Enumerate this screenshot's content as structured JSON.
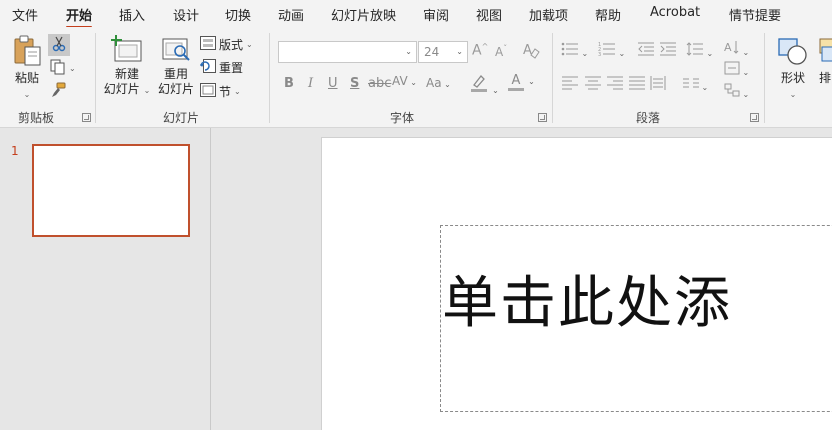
{
  "menu": {
    "tabs": [
      {
        "label": "文件",
        "active": false
      },
      {
        "label": "开始",
        "active": true
      },
      {
        "label": "插入",
        "active": false
      },
      {
        "label": "设计",
        "active": false
      },
      {
        "label": "切换",
        "active": false
      },
      {
        "label": "动画",
        "active": false
      },
      {
        "label": "幻灯片放映",
        "active": false
      },
      {
        "label": "审阅",
        "active": false
      },
      {
        "label": "视图",
        "active": false
      },
      {
        "label": "加载项",
        "active": false
      },
      {
        "label": "帮助",
        "active": false
      },
      {
        "label": "Acrobat",
        "active": false
      },
      {
        "label": "情节提要",
        "active": false
      }
    ]
  },
  "ribbon": {
    "clipboard": {
      "paste_label": "粘贴",
      "group_label": "剪贴板"
    },
    "slides": {
      "new_slide_line1": "新建",
      "new_slide_line2": "幻灯片",
      "reuse_slides_line1": "重用",
      "reuse_slides_line2": "幻灯片",
      "layout_label": "版式",
      "reset_label": "重置",
      "section_label": "节",
      "group_label": "幻灯片"
    },
    "font": {
      "font_name_value": "",
      "font_size_value": "24",
      "group_label": "字体",
      "bold": "B",
      "italic": "I",
      "underline": "U",
      "strike": "S",
      "spacing": "AV",
      "change_case": "Aa",
      "font_color": "A",
      "grow": "A",
      "shrink": "A"
    },
    "paragraph": {
      "group_label": "段落"
    },
    "drawing": {
      "shapes_label": "形状",
      "arrange_label": "排"
    }
  },
  "thumbnails": {
    "slide_number": "1"
  },
  "slide": {
    "title_placeholder": "单击此处添"
  },
  "colors": {
    "accent": "#c43e1c",
    "thumb_border": "#c0502d",
    "ribbon_bg": "#f3f3f3",
    "workspace_bg": "#e6e6e6"
  }
}
